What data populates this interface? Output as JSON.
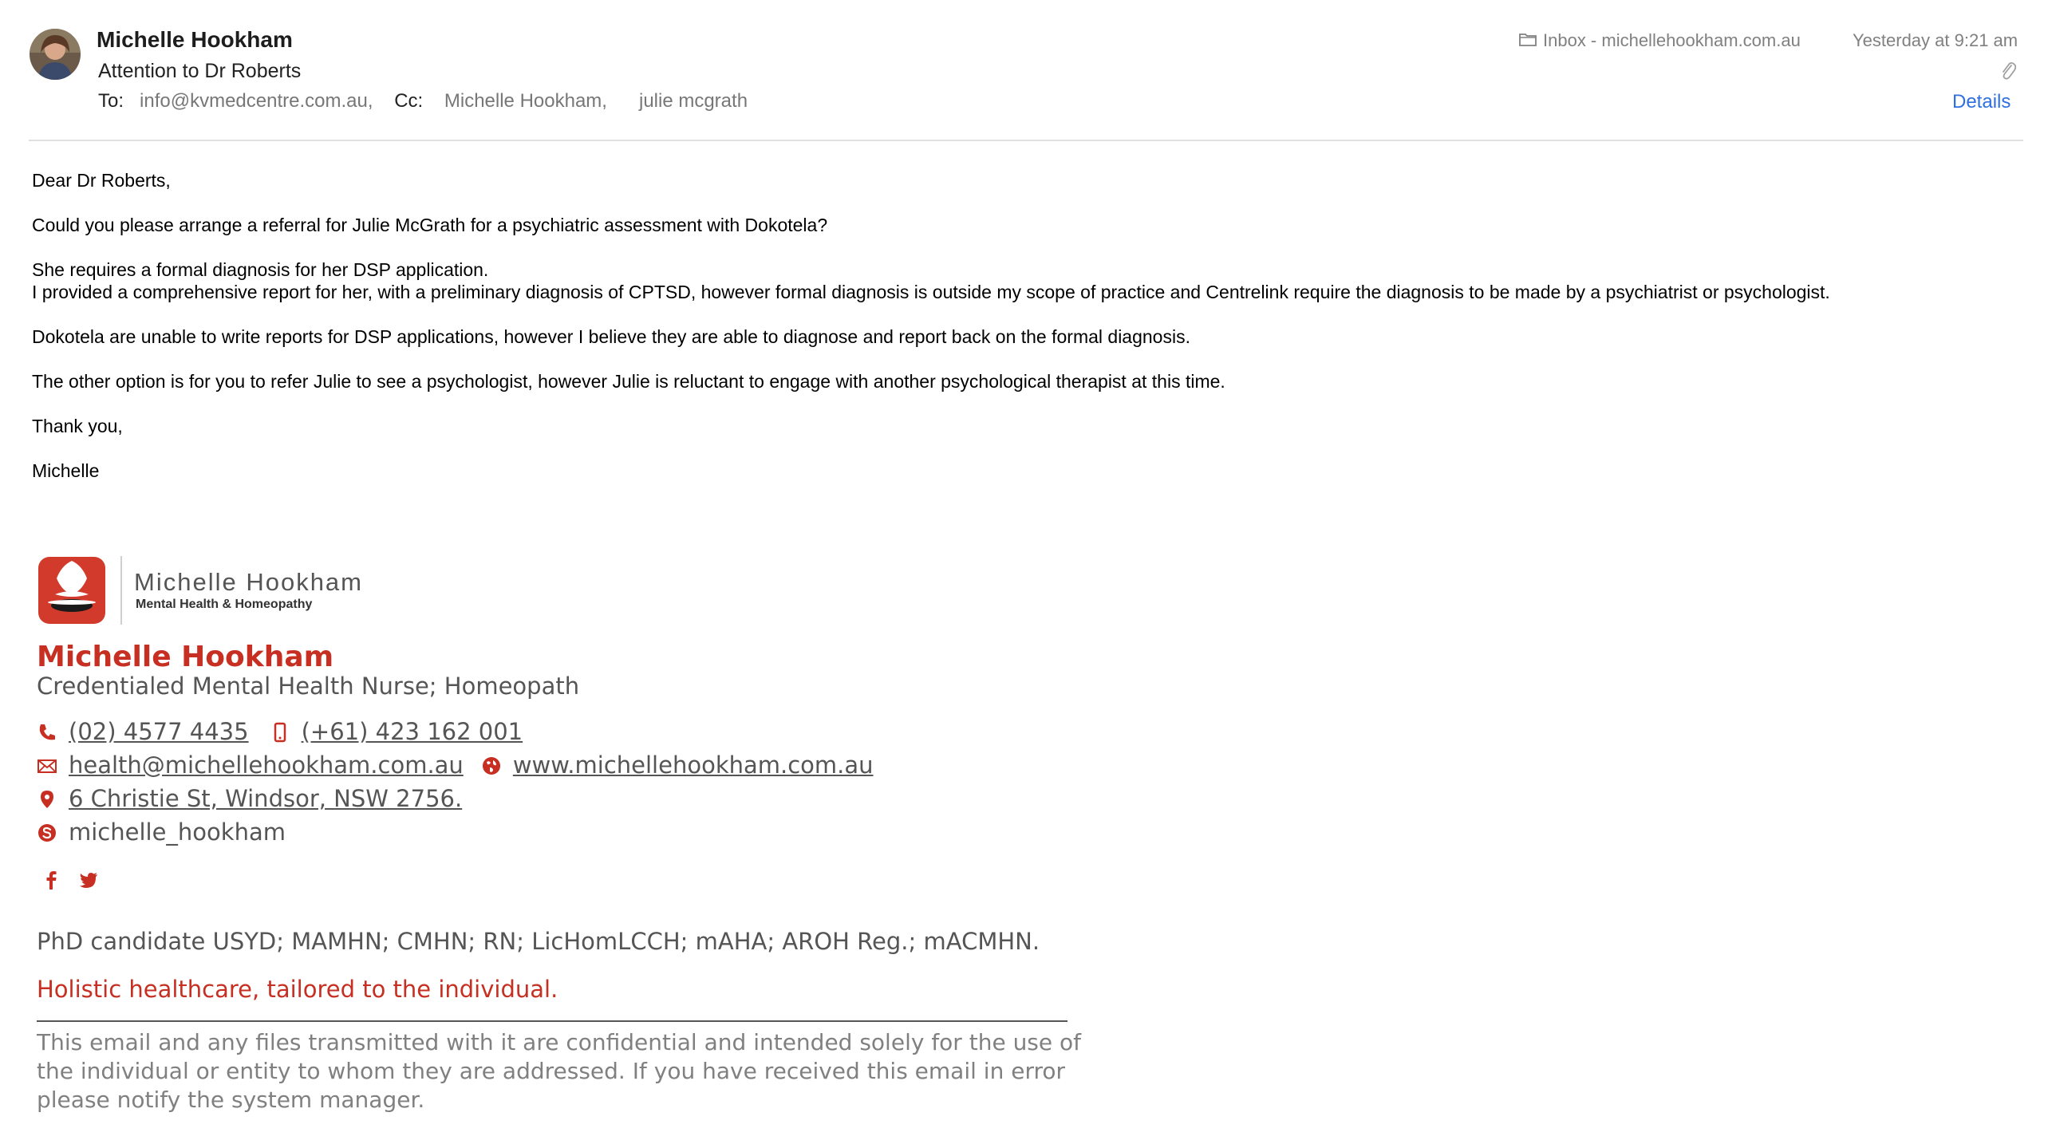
{
  "header": {
    "sender": "Michelle Hookham",
    "subject": "Attention to Dr Roberts",
    "to_label": "To:",
    "to": "info@kvmedcentre.com.au,",
    "cc_label": "Cc:",
    "cc1": "Michelle Hookham,",
    "cc2": "julie mcgrath",
    "mailbox": "Inbox - michellehookham.com.au",
    "date": "Yesterday at 9:21 am",
    "details": "Details"
  },
  "body": {
    "greeting": "Dear Dr Roberts,",
    "p1": "Could you please arrange a referral for Julie McGrath for a psychiatric assessment with Dokotela?",
    "p2a": "She requires a formal diagnosis for her DSP application.",
    "p2b": "I provided a comprehensive report for her, with a preliminary diagnosis of CPTSD, however formal diagnosis is outside my scope of practice and Centrelink require the diagnosis to be made by a psychiatrist or psychologist.",
    "p3": "Dokotela are unable to write reports for DSP applications, however I believe they are able to diagnose and report back on the formal diagnosis.",
    "p4": "The other option is for you to refer Julie to see a psychologist, however Julie is reluctant to engage with another psychological therapist at this time.",
    "closing": "Thank you,",
    "signoff": "Michelle"
  },
  "signature": {
    "brand_name": "Michelle Hookham",
    "brand_sub": "Mental Health & Homeopathy",
    "name": "Michelle Hookham",
    "title": "Credentialed Mental Health Nurse; Homeopath",
    "phone": "(02) 4577 4435",
    "mobile": "(+61) 423 162 001",
    "email": "health@michellehookham.com.au",
    "website": "www.michellehookham.com.au",
    "address": "6 Christie St, Windsor, NSW 2756.",
    "skype": "michelle_hookham",
    "qualifications": "PhD candidate USYD; MAMHN; CMHN; RN; LicHomLCCH; mAHA; AROH Reg.; mACMHN.",
    "tagline": "Holistic healthcare, tailored to the individual.",
    "disclaimer": "This email and any files transmitted with it are confidential and intended solely for the use of the individual or entity to whom they are addressed. If you have received this email in error please notify the system manager."
  },
  "colors": {
    "accent": "#c62f22",
    "link": "#2f6fe0",
    "muted": "#808080"
  },
  "icons": [
    "folder-icon",
    "paperclip-icon",
    "phone-icon",
    "mobile-icon",
    "email-icon",
    "globe-icon",
    "location-icon",
    "skype-icon",
    "facebook-icon",
    "twitter-icon"
  ]
}
